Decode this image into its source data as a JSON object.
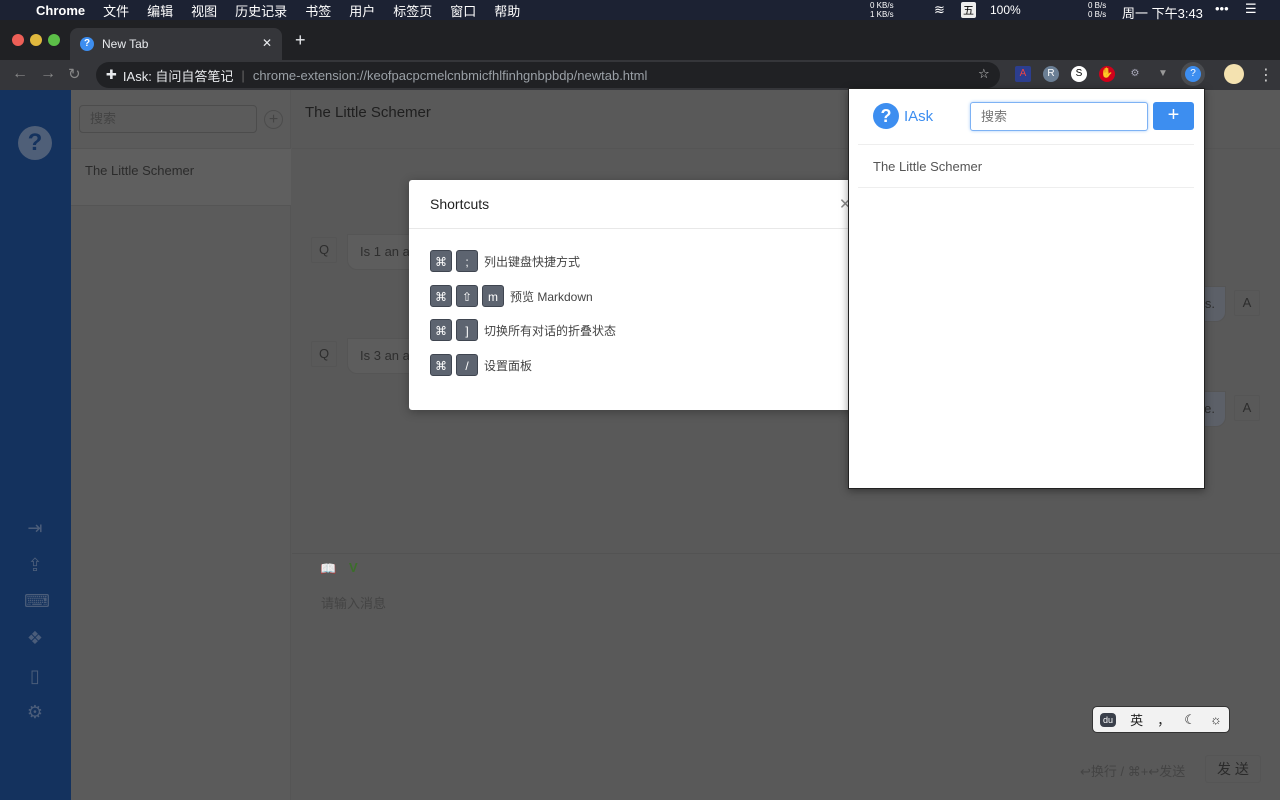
{
  "menubar": {
    "app": "Chrome",
    "items": [
      "文件",
      "编辑",
      "视图",
      "历史记录",
      "书签",
      "用户",
      "标签页",
      "窗口",
      "帮助"
    ],
    "net_up": "0 KB/s",
    "net_down": "1 KB/s",
    "input_method": "五",
    "battery": "100%",
    "disk_read": "0 B/s",
    "disk_write": "0 B/s",
    "clock": "周一 下午3:43"
  },
  "browser": {
    "tab_title": "New Tab",
    "address_label": "IAsk: 自问自答笔记",
    "url": "chrome-extension://keofpacpcmelcnbmicfhlfinhgnbpbdp/newtab.html",
    "extensions": [
      "A",
      "R",
      "S",
      "stop",
      "gear",
      "V",
      "?"
    ]
  },
  "sidebar": {
    "icons": [
      "logout-icon",
      "upload-icon",
      "keyboard-icon",
      "dropbox-icon",
      "markdown-file-icon",
      "settings-icon"
    ]
  },
  "list": {
    "search_placeholder": "搜索",
    "items": [
      "The Little Schemer"
    ]
  },
  "main": {
    "title": "The Little Schemer",
    "messages": [
      {
        "q_label": "Q",
        "question": "Is 1 an a",
        "a_label": "A",
        "answer": "s."
      },
      {
        "q_label": "Q",
        "question": "Is 3 an a",
        "a_label": "A",
        "answer": "e."
      }
    ],
    "input_placeholder": "请输入消息",
    "hint": "↩换行 / ⌘+↩发送",
    "send": "发 送"
  },
  "modal": {
    "title": "Shortcuts",
    "shortcuts": [
      {
        "keys": [
          "⌘",
          ";"
        ],
        "desc": "列出键盘快捷方式"
      },
      {
        "keys": [
          "⌘",
          "⇧",
          "m"
        ],
        "desc": "预览 Markdown"
      },
      {
        "keys": [
          "⌘",
          "]"
        ],
        "desc": "切换所有对话的折叠状态"
      },
      {
        "keys": [
          "⌘",
          "/"
        ],
        "desc": "设置面板"
      }
    ]
  },
  "popup": {
    "brand": "IAsk",
    "search_placeholder": "搜索",
    "add": "+",
    "items": [
      "The Little Schemer"
    ]
  },
  "ime": {
    "lang": "英",
    "punct": "，"
  },
  "colors": {
    "accent": "#3d8ef0",
    "sidebar": "#14325e"
  }
}
